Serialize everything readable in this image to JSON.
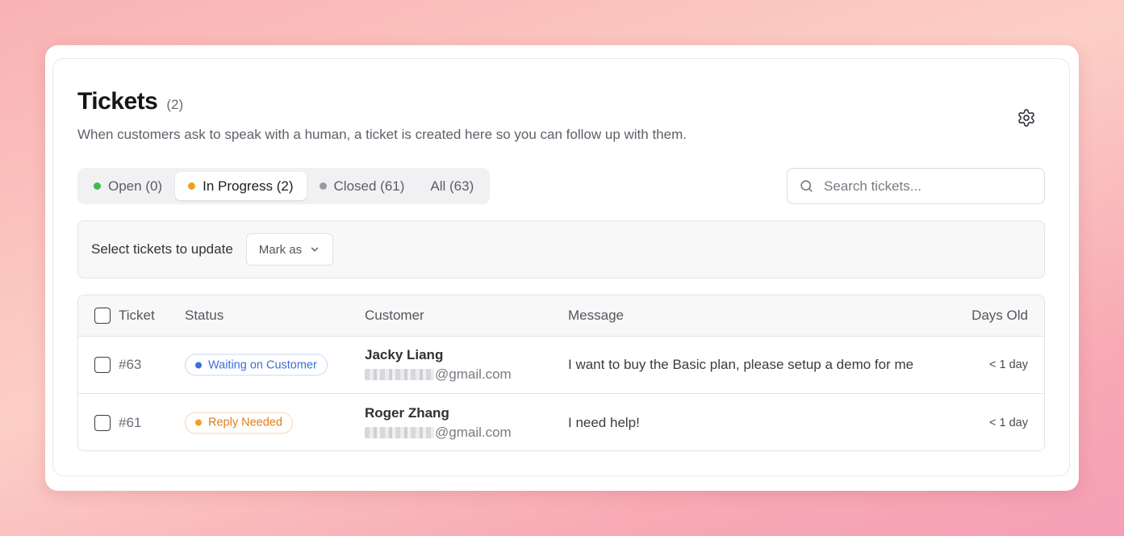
{
  "header": {
    "title": "Tickets",
    "count": "(2)",
    "subtitle": "When customers ask to speak with a human, a ticket is created here so you can follow up with them."
  },
  "tabs": [
    {
      "label": "Open (0)",
      "dot_color": "#3fb950",
      "active": false
    },
    {
      "label": "In Progress (2)",
      "dot_color": "#f0a01f",
      "active": true
    },
    {
      "label": "Closed (61)",
      "dot_color": "#9a9aa2",
      "active": false
    },
    {
      "label": "All (63)",
      "dot_color": null,
      "active": false
    }
  ],
  "search": {
    "placeholder": "Search tickets...",
    "value": "",
    "icon": "search-icon"
  },
  "bulk": {
    "label": "Select tickets to update",
    "mark_as_label": "Mark as",
    "icon": "chevron-down-icon"
  },
  "table": {
    "columns": [
      "Ticket",
      "Status",
      "Customer",
      "Message",
      "Days Old"
    ],
    "rows": [
      {
        "id": "#63",
        "status": "Waiting on Customer",
        "status_color": "#3b6fd9",
        "status_border": "#c9d6f3",
        "customer_name": "Jacky Liang",
        "customer_email_domain": "@gmail.com",
        "message": "I want to buy the Basic plan, please setup a demo for me",
        "days_old": "< 1 day"
      },
      {
        "id": "#61",
        "status": "Reply Needed",
        "status_color": "#e07d18",
        "status_border": "#f5d3b3",
        "customer_name": "Roger Zhang",
        "customer_email_domain": "@gmail.com",
        "message": "I need help!",
        "days_old": "< 1 day"
      }
    ]
  },
  "settings": {
    "icon": "gear-icon"
  }
}
